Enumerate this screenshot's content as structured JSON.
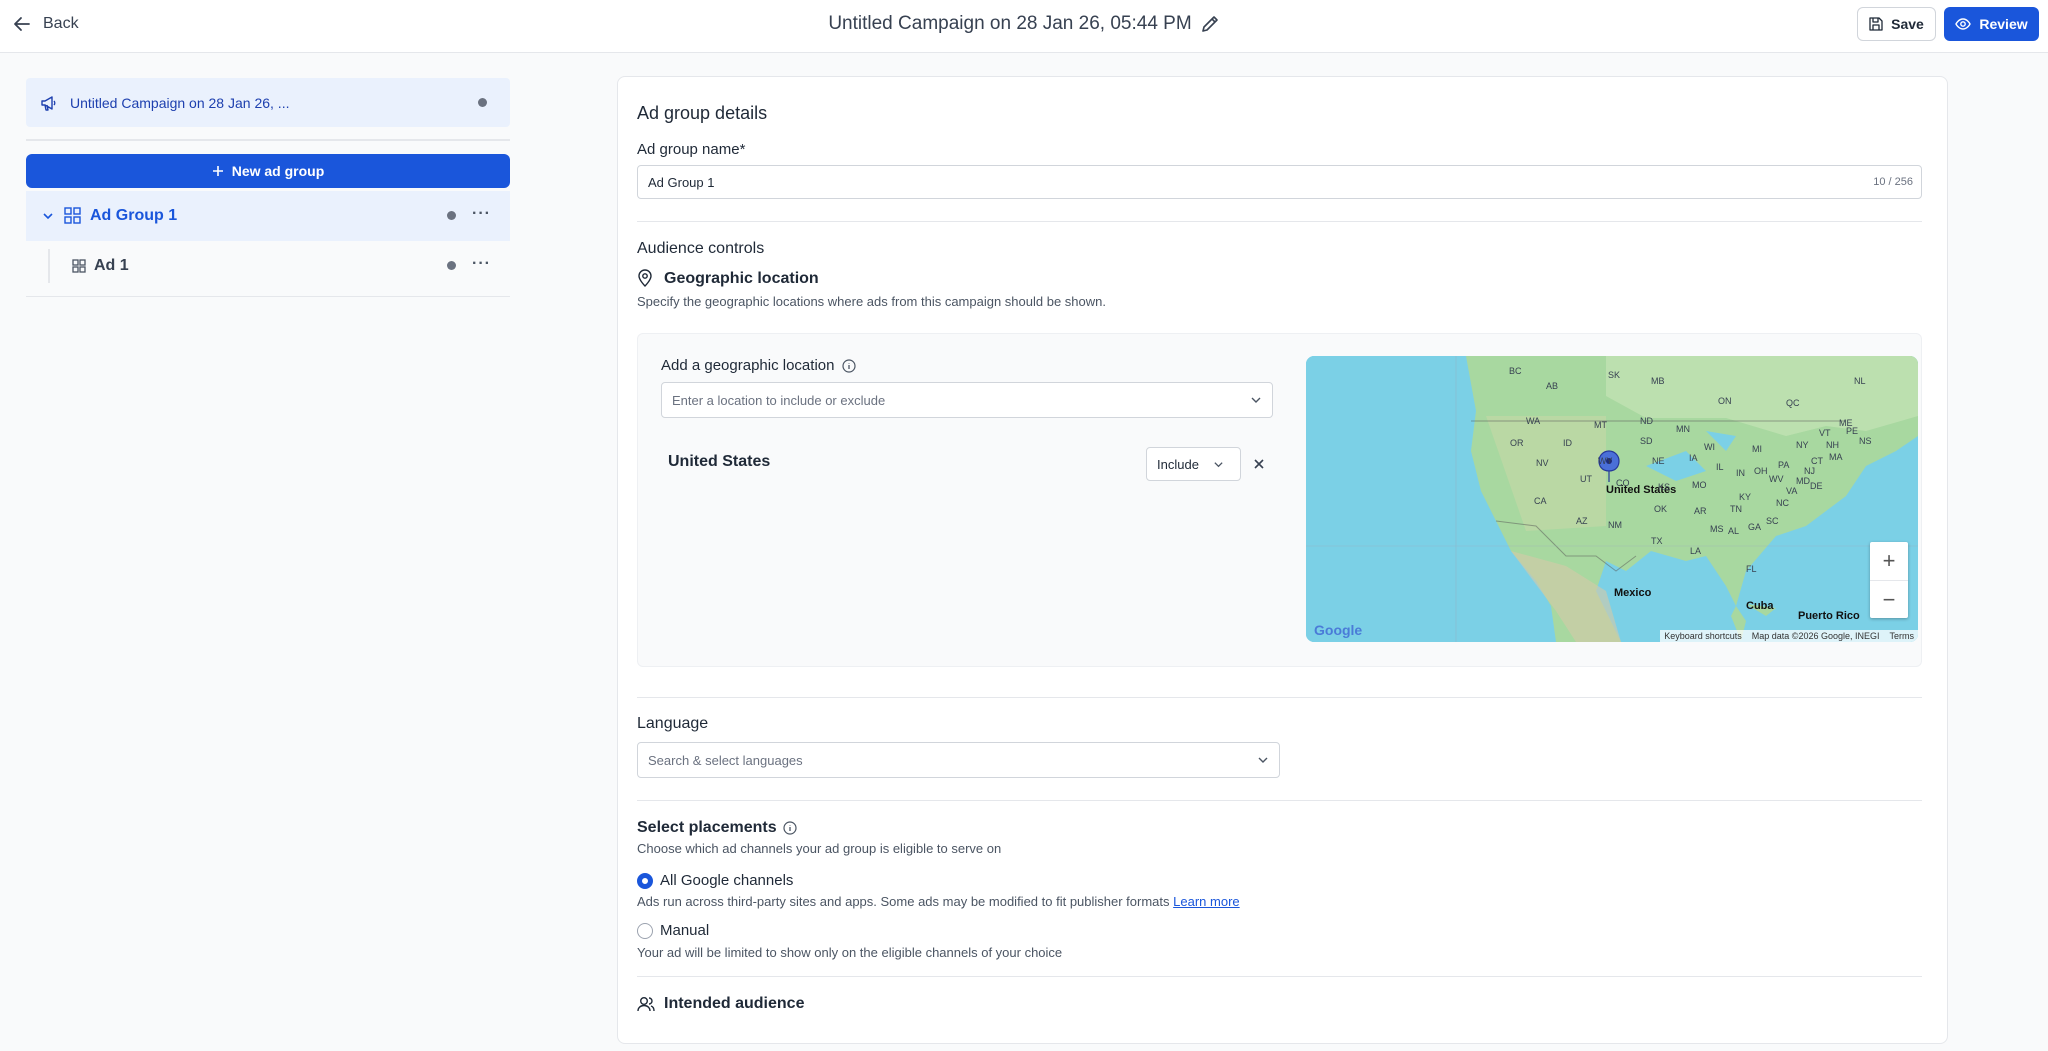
{
  "header": {
    "back_label": "Back",
    "title": "Untitled Campaign on 28 Jan 26, 05:44 PM",
    "save_label": "Save",
    "review_label": "Review"
  },
  "sidebar": {
    "campaign_name": "Untitled Campaign on 28 Jan 26, ...",
    "new_group_label": "New ad group",
    "ad_group_label": "Ad Group 1",
    "ad_label": "Ad 1",
    "more_label": "···"
  },
  "main": {
    "section_title": "Ad group details",
    "group_name_label": "Ad group name*",
    "group_name_value": "Ad Group 1",
    "group_name_counter": "10 / 256",
    "audience_title": "Audience controls",
    "geo_title": "Geographic location",
    "geo_help": "Specify the geographic locations where ads from this campaign should be shown.",
    "add_geo_label": "Add a geographic location",
    "geo_placeholder": "Enter a location to include or exclude",
    "selected_location": "United States",
    "include_value": "Include",
    "language_title": "Language",
    "language_placeholder": "Search & select languages",
    "placements_title": "Select placements",
    "placements_help": "Choose which ad channels your ad group is eligible to serve on",
    "option_all_label": "All Google channels",
    "option_all_help": "Ads run across third-party sites and apps. Some ads may be modified to fit publisher formats",
    "learn_more": "Learn more",
    "option_manual_label": "Manual",
    "option_manual_help": "Your ad will be limited to show only on the eligible channels of your choice",
    "selected_option": "All Google channels",
    "intended_audience_title": "Intended audience"
  },
  "map": {
    "country_label": "United States",
    "mexico_label": "Mexico",
    "cuba_label": "Cuba",
    "puerto_rico_label": "Puerto Rico",
    "google_logo": "Google",
    "shortcuts": "Keyboard shortcuts",
    "map_data": "Map data ©2026 Google, INEGI",
    "terms": "Terms",
    "zoom_in": "+",
    "zoom_out": "−",
    "state_labels": [
      "BC",
      "AB",
      "SK",
      "MB",
      "ON",
      "QC",
      "NL",
      "PE",
      "NS",
      "WA",
      "MT",
      "ND",
      "MN",
      "OR",
      "ID",
      "SD",
      "WI",
      "MI",
      "NY",
      "VT",
      "ME",
      "NH",
      "MA",
      "CT",
      "NJ",
      "PA",
      "NV",
      "WY",
      "NE",
      "IA",
      "IL",
      "OH",
      "MD",
      "DE",
      "UT",
      "CO",
      "KS",
      "MO",
      "IN",
      "WV",
      "VA",
      "CA",
      "KY",
      "NC",
      "AZ",
      "NM",
      "OK",
      "TN",
      "AR",
      "SC",
      "MS",
      "AL",
      "GA",
      "TX",
      "LA",
      "FL"
    ]
  },
  "colors": {
    "primary": "#1a56db",
    "water": "#7bd0e6",
    "land": "#a8d8a0"
  }
}
